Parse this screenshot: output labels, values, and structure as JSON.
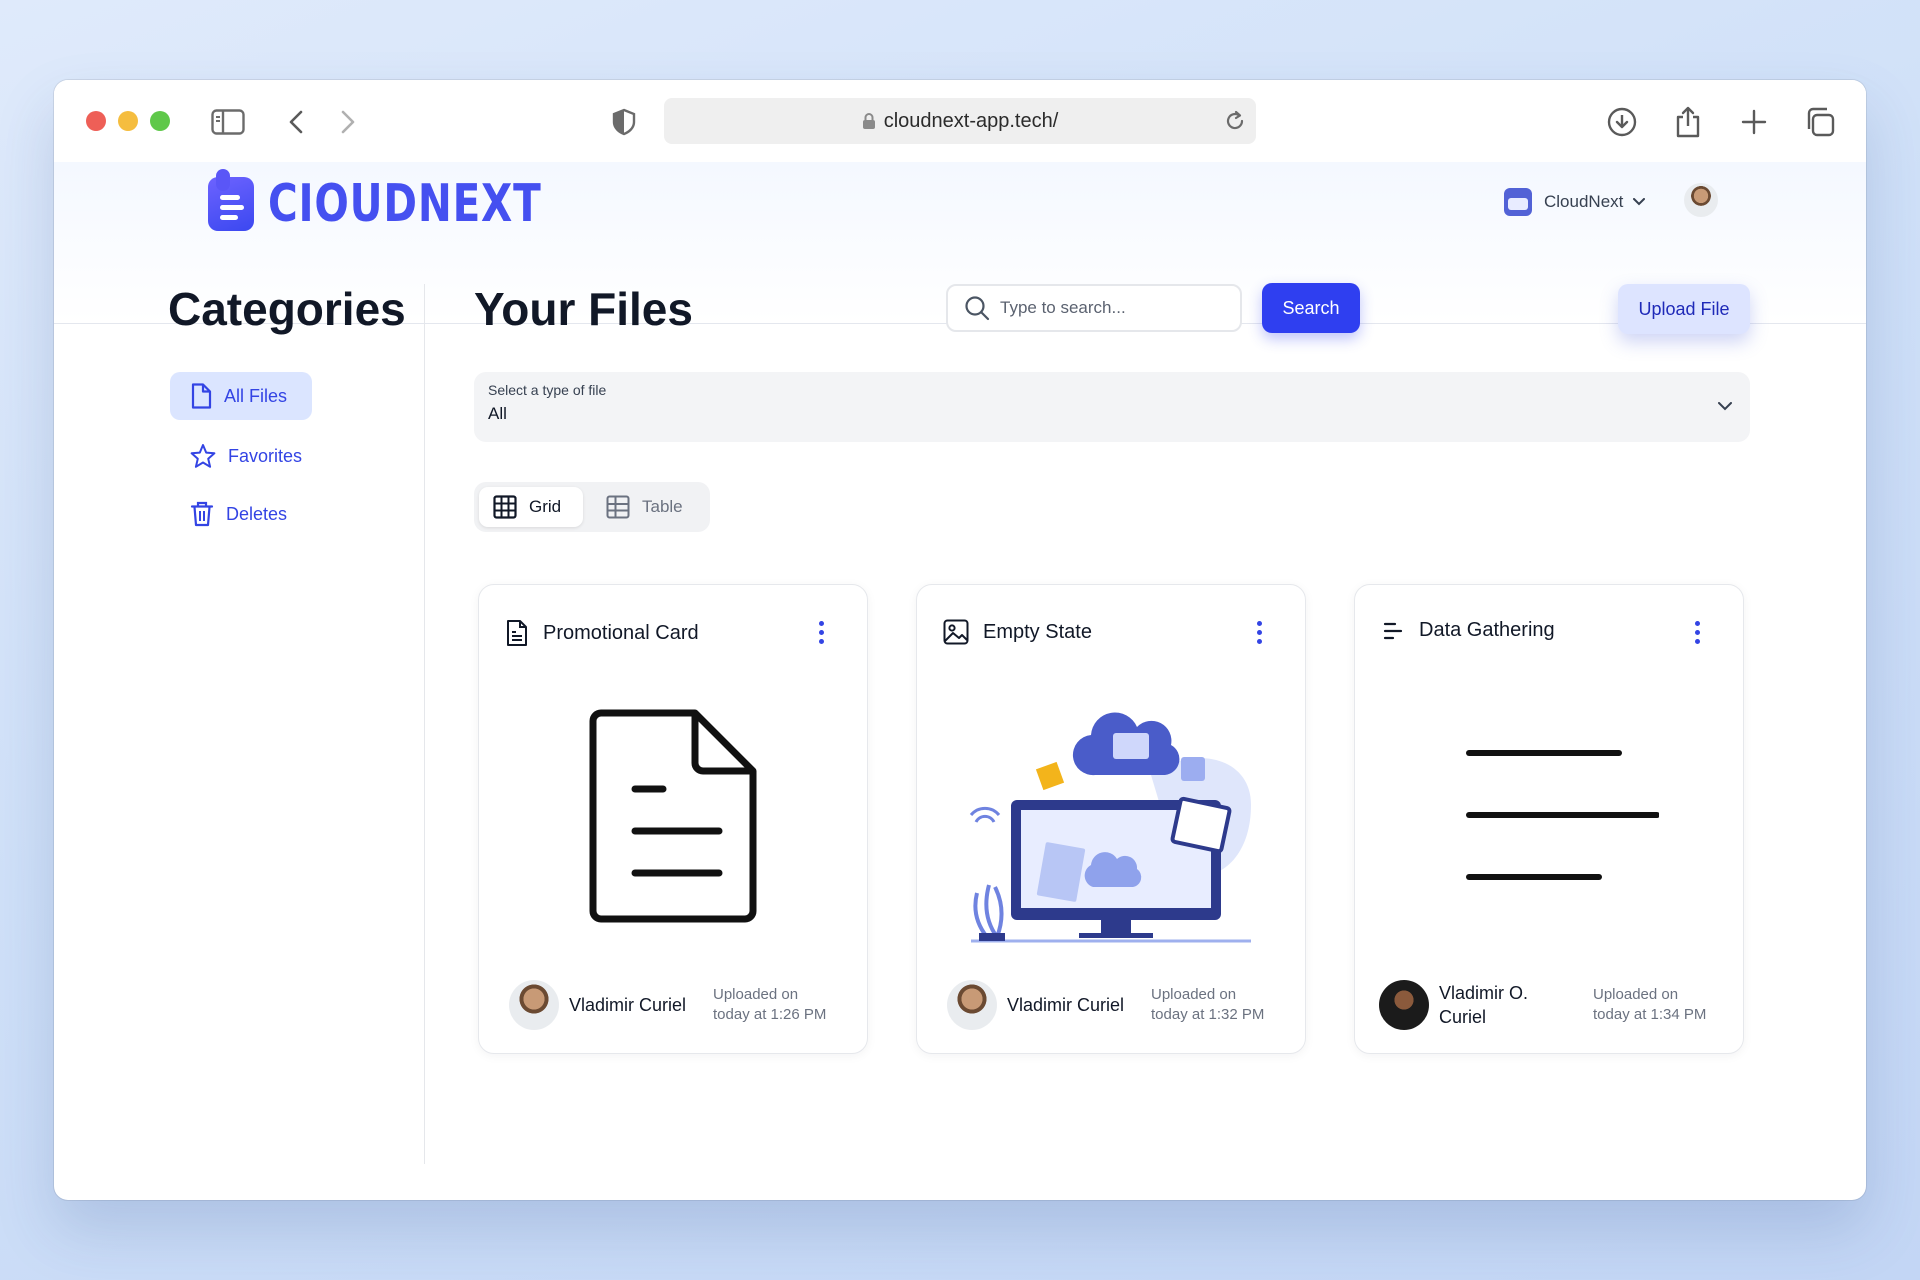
{
  "browser": {
    "url": "cloudnext-app.tech/"
  },
  "header": {
    "logo_text": "CIOUDNEXT",
    "workspace_name": "CloudNext"
  },
  "sidebar": {
    "title": "Categories",
    "items": [
      {
        "label": "All Files",
        "icon": "file-icon",
        "active": true
      },
      {
        "label": "Favorites",
        "icon": "star-icon",
        "active": false
      },
      {
        "label": "Deletes",
        "icon": "trash-icon",
        "active": false
      }
    ]
  },
  "main": {
    "title": "Your Files",
    "search": {
      "placeholder": "Type to search...",
      "button_label": "Search"
    },
    "upload_label": "Upload File",
    "filter": {
      "label": "Select a type of file",
      "value": "All"
    },
    "views": {
      "grid_label": "Grid",
      "table_label": "Table",
      "selected": "Grid"
    }
  },
  "files": [
    {
      "name": "Promotional Card",
      "type_icon": "document-icon",
      "owner": "Vladimir Curiel",
      "uploaded_line1": "Uploaded on",
      "uploaded_line2": "today at 1:26 PM"
    },
    {
      "name": "Empty State",
      "type_icon": "image-icon",
      "owner": "Vladimir Curiel",
      "uploaded_line1": "Uploaded on",
      "uploaded_line2": "today at 1:32 PM"
    },
    {
      "name": "Data Gathering",
      "type_icon": "text-lines-icon",
      "owner": "Vladimir O. Curiel",
      "uploaded_line1": "Uploaded on",
      "uploaded_line2": "today at 1:34 PM"
    }
  ],
  "colors": {
    "accent": "#2f3ff0",
    "accent_soft": "#dbe5ff",
    "sidebar_link": "#3344e4"
  }
}
